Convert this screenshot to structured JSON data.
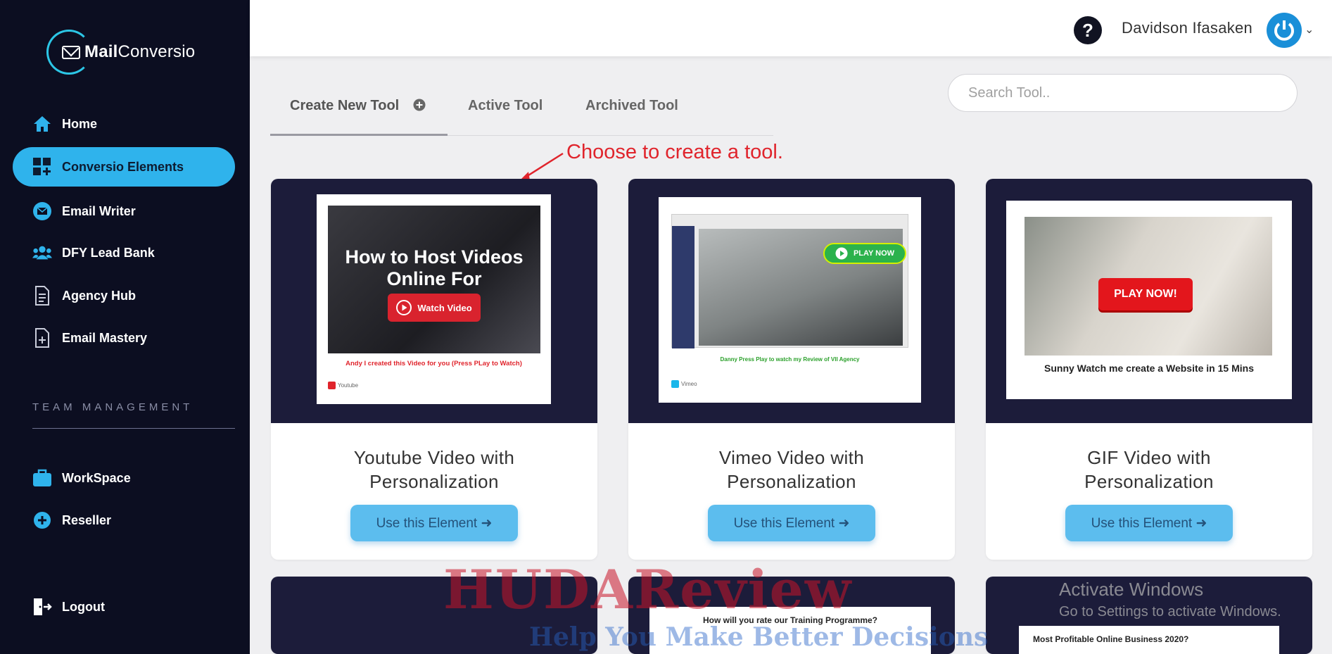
{
  "brand": {
    "name_bold": "Mail",
    "name_rest": "Conversio"
  },
  "sidebar": {
    "items": [
      {
        "label": "Home",
        "icon": "home-icon"
      },
      {
        "label": "Conversio Elements",
        "icon": "grid-plus-icon"
      },
      {
        "label": "Email Writer",
        "icon": "envelope-icon"
      },
      {
        "label": "DFY Lead Bank",
        "icon": "users-icon"
      },
      {
        "label": "Agency Hub",
        "icon": "document-icon"
      },
      {
        "label": "Email Mastery",
        "icon": "file-plus-icon"
      }
    ],
    "section_label": "TEAM MANAGEMENT",
    "team_items": [
      {
        "label": "WorkSpace",
        "icon": "briefcase-icon"
      },
      {
        "label": "Reseller",
        "icon": "plus-circle-icon"
      }
    ],
    "logout": {
      "label": "Logout",
      "icon": "logout-icon"
    },
    "active_color": "#2fb3ec"
  },
  "header": {
    "help_symbol": "?",
    "user_name": "Davidson Ifasaken",
    "chevron": "⌄"
  },
  "tabs": [
    {
      "label": "Create New Tool",
      "active": true
    },
    {
      "label": "Active Tool"
    },
    {
      "label": "Archived Tool"
    }
  ],
  "search": {
    "placeholder": "Search Tool.."
  },
  "annotation": "Choose to create a tool.",
  "cards": [
    {
      "title_line1": "Youtube Video with",
      "title_line2": "Personalization",
      "button": "Use this Element",
      "thumb_heading": "How to Host Videos Online For",
      "thumb_button": "Watch Video",
      "thumb_caption": "Andy I created this Video for you (Press PLay to Watch)",
      "thumb_source": "Youtube"
    },
    {
      "title_line1": "Vimeo Video with",
      "title_line2": "Personalization",
      "button": "Use this Element",
      "thumb_button": "PLAY NOW",
      "thumb_caption": "Danny Press Play to watch my Review of VII Agency",
      "thumb_source": "Vimeo"
    },
    {
      "title_line1": "GIF Video with",
      "title_line2": "Personalization",
      "button": "Use this Element",
      "thumb_button": "PLAY NOW!",
      "thumb_caption": "Sunny Watch me create a Website in 15 Mins"
    }
  ],
  "second_row": {
    "card2_text": "How will you rate our Training Programme?",
    "card3_text": "Most Profitable Online Business 2020?"
  },
  "overlays": {
    "watermark": "HUDAReview",
    "watermark_sub": "Help You Make Better Decisions",
    "windows_line1": "Activate Windows",
    "windows_line2": "Go to Settings to activate Windows."
  }
}
